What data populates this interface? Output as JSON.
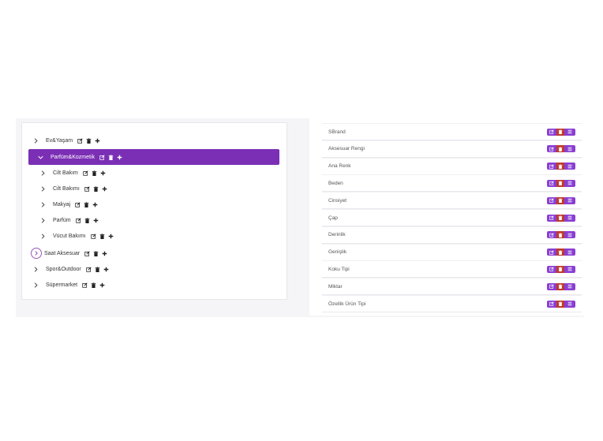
{
  "colors": {
    "accent": "#7b2fb5",
    "button": "#8a3fd1",
    "delete": "#c0392b"
  },
  "tree": {
    "items": [
      {
        "label": "Ev&Yaşam",
        "level": 0,
        "selected": false
      },
      {
        "label": "Parfüm&Kozmetik",
        "level": 0,
        "selected": true
      },
      {
        "label": "Cilt Bakım",
        "level": 1,
        "selected": false
      },
      {
        "label": "Cilt Bakımı",
        "level": 1,
        "selected": false
      },
      {
        "label": "Makyaj",
        "level": 1,
        "selected": false
      },
      {
        "label": "Parfüm",
        "level": 1,
        "selected": false
      },
      {
        "label": "Vücut Bakımı",
        "level": 1,
        "selected": false
      },
      {
        "label": "Saat Aksesuar",
        "level": 0,
        "selected": false,
        "focused": true
      },
      {
        "label": "Spor&Outdoor",
        "level": 0,
        "selected": false
      },
      {
        "label": "Süpermarket",
        "level": 0,
        "selected": false
      }
    ]
  },
  "attributes": {
    "items": [
      "SBrand",
      "Aksesuar Rengi",
      "Ana Renk",
      "Beden",
      "Cinsiyet",
      "Çap",
      "Derinlik",
      "Genişlik",
      "Koku Tipi",
      "Miktar",
      "Özellik Ürün Tipi"
    ]
  }
}
